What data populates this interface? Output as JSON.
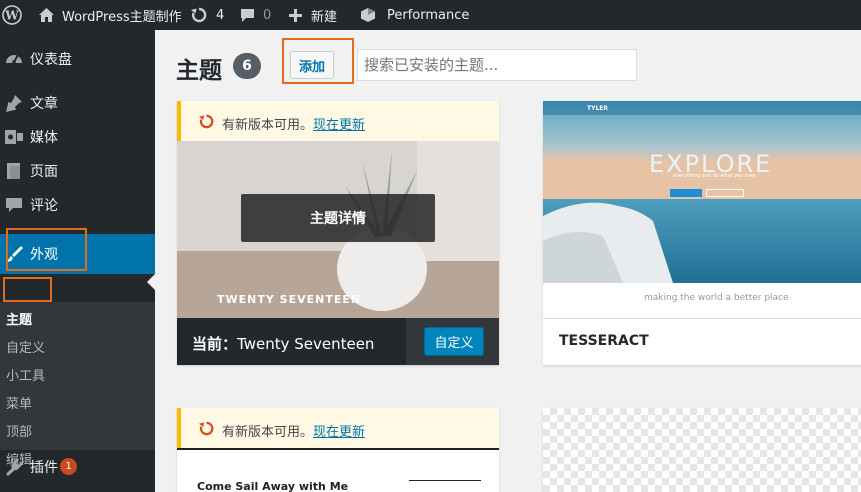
{
  "admin_bar": {
    "site_name": "WordPress主题制作",
    "updates_count": "4",
    "comments_count": "0",
    "new_label": "新建",
    "performance_label": "Performance"
  },
  "sidebar": {
    "items": [
      {
        "label": "仪表盘",
        "icon": "dashboard-icon"
      },
      {
        "label": "文章",
        "icon": "pushpin-icon"
      },
      {
        "label": "媒体",
        "icon": "media-icon"
      },
      {
        "label": "页面",
        "icon": "page-icon"
      },
      {
        "label": "评论",
        "icon": "comment-icon"
      },
      {
        "label": "外观",
        "icon": "paintbrush-icon"
      },
      {
        "label": "插件",
        "icon": "plugin-icon",
        "badge": "1"
      }
    ],
    "submenu": [
      "主题",
      "自定义",
      "小工具",
      "菜单",
      "顶部",
      "编辑"
    ]
  },
  "header": {
    "title": "主题",
    "count": "6",
    "add_label": "添加",
    "search_placeholder": "搜索已安装的主题..."
  },
  "themes": [
    {
      "notice_text": "有新版本可用。",
      "notice_link": "现在更新",
      "details_label": "主题详情",
      "screenshot_title": "TWENTY SEVENTEEN",
      "current_prefix": "当前：",
      "name": "Twenty Seventeen",
      "customize_label": "自定义"
    },
    {
      "name": "TESSERACT",
      "hero_title": "EXPLORE",
      "hero_subtitle": "everything and do what you love",
      "tagline": "making the world a better place",
      "nav_brand": "TYLER"
    },
    {
      "notice_text": "有新版本可用。",
      "notice_link": "现在更新",
      "preview_title": "Come Sail Away with Me"
    }
  ],
  "colors": {
    "admin_bar": "#23282d",
    "accent": "#0073aa",
    "highlight": "#e06c1d",
    "notice_border": "#ffb900"
  }
}
